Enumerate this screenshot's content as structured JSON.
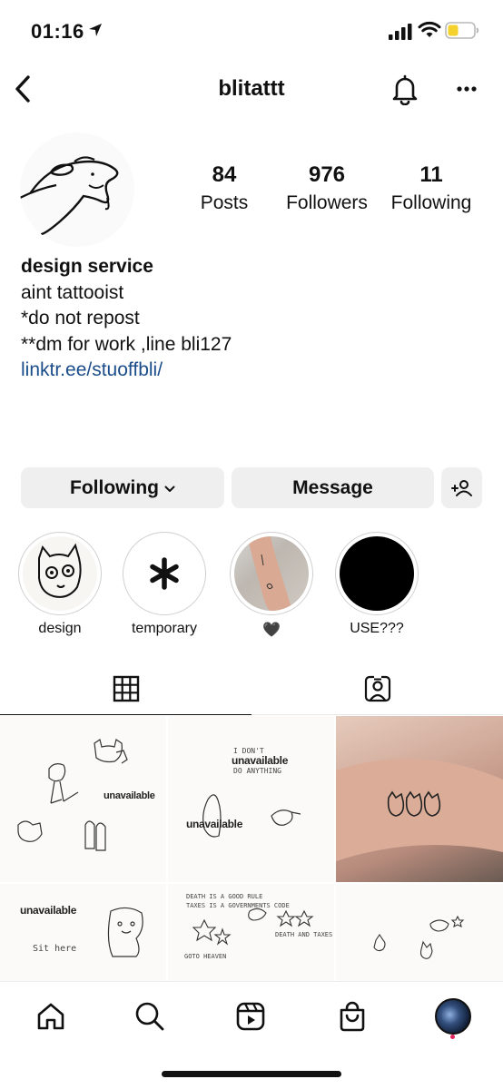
{
  "status_bar": {
    "time": "01:16"
  },
  "header": {
    "username": "blitattt"
  },
  "profile": {
    "stats": [
      {
        "value": "84",
        "label": "Posts"
      },
      {
        "value": "976",
        "label": "Followers"
      },
      {
        "value": "11",
        "label": "Following"
      }
    ],
    "bio": {
      "name": "design service",
      "lines": [
        "aint tattooist",
        "*do not repost",
        "**dm for work ,line bli127"
      ],
      "link": "linktr.ee/stuoffbli/"
    }
  },
  "actions": {
    "following_label": "Following",
    "message_label": "Message"
  },
  "highlights": [
    {
      "label": "design"
    },
    {
      "label": "temporary"
    },
    {
      "label": "🖤"
    },
    {
      "label": "USE???"
    }
  ],
  "grid": {
    "posts": [
      {
        "texts": [
          "unavailable"
        ]
      },
      {
        "texts": [
          "unavailable",
          "unavailable",
          "I DON'T",
          "DO ANYTHING"
        ]
      },
      {
        "texts": []
      },
      {
        "texts": [
          "unavailable",
          "Sit here"
        ]
      },
      {
        "texts": [
          "DEATH IS A GOOD RULE",
          "TAXES IS A GOVERNMENTS CODE",
          "GOTO HEAVEN",
          "DEATH AND TAXES"
        ]
      },
      {
        "texts": []
      }
    ]
  },
  "colors": {
    "link": "#1b4d8a",
    "button_bg": "#efefef",
    "battery": "#f5d12e",
    "notification_dot": "#e0245e"
  },
  "icons": {
    "back": "chevron-left-icon",
    "bell": "bell-icon",
    "more": "more-horizontal-icon",
    "grid_tab": "grid-icon",
    "tagged_tab": "tagged-person-icon",
    "nav": [
      "home-icon",
      "search-icon",
      "reels-icon",
      "shop-bag-icon",
      "profile-avatar"
    ]
  }
}
